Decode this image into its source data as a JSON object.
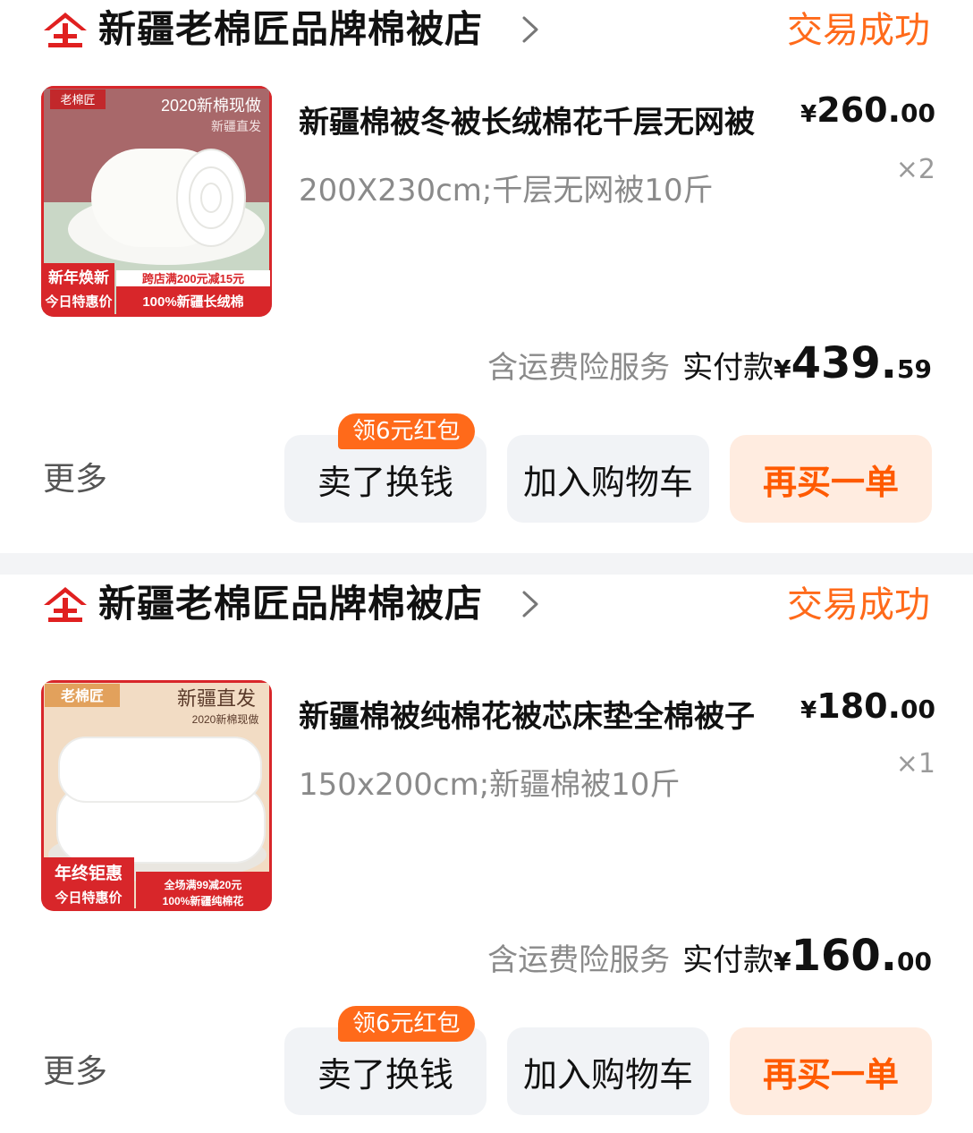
{
  "orders": [
    {
      "shop_name": "新疆老棉匠品牌棉被店",
      "status": "交易成功",
      "product": {
        "thumb_top_brand": "老棉匠",
        "thumb_top_text": "2020新棉现做",
        "thumb_top_sub": "新疆直发",
        "thumb_promo_left_1": "新年焕新",
        "thumb_promo_left_2": "今日特惠价",
        "thumb_promo_right_1": "跨店满200元减15元",
        "thumb_promo_right_2": "100%新疆长绒棉",
        "title": "新疆棉被冬被长绒棉花千层无网被",
        "spec": "200X230cm;千层无网被10斤",
        "price_yen": "¥",
        "price_int": "260.",
        "price_dec": "00",
        "quantity": "×2"
      },
      "insurance_note": "含运费险服务",
      "paid_label": "实付款",
      "paid_yen": "¥",
      "paid_int": "439.",
      "paid_dec": "59",
      "more": "更多",
      "promo_badge": "领6元红包",
      "btn_sell": "卖了换钱",
      "btn_cart": "加入购物车",
      "btn_rebuy": "再买一单"
    },
    {
      "shop_name": "新疆老棉匠品牌棉被店",
      "status": "交易成功",
      "product": {
        "thumb_top_brand": "老棉匠",
        "thumb_top_text": "新疆直发",
        "thumb_top_sub": "2020新棉现做",
        "thumb_promo_left_1": "年终钜惠",
        "thumb_promo_left_2": "今日特惠价",
        "thumb_promo_right_1": "全场满99减20元",
        "thumb_promo_right_2": "100%新疆纯棉花",
        "title": "新疆棉被纯棉花被芯床垫全棉被子",
        "spec": "150x200cm;新疆棉被10斤",
        "price_yen": "¥",
        "price_int": "180.",
        "price_dec": "00",
        "quantity": "×1"
      },
      "insurance_note": "含运费险服务",
      "paid_label": "实付款",
      "paid_yen": "¥",
      "paid_int": "160.",
      "paid_dec": "00",
      "more": "更多",
      "promo_badge": "领6元红包",
      "btn_sell": "卖了换钱",
      "btn_cart": "加入购物车",
      "btn_rebuy": "再买一单"
    }
  ],
  "colors": {
    "accent_orange": "#ff6a1a",
    "rebuy_text": "#ff5a00",
    "rebuy_bg": "#ffece0",
    "shop_icon_red": "#e02020",
    "page_bg": "#f3f4f6"
  },
  "icons": {
    "shop": "store-brand-icon",
    "chevron": "chevron-right-icon"
  }
}
